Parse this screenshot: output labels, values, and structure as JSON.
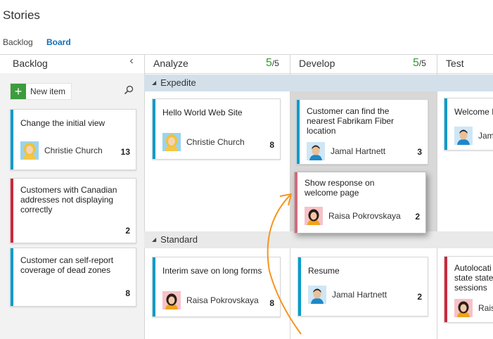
{
  "page": {
    "title": "Stories"
  },
  "tabs": {
    "backlog": "Backlog",
    "board": "Board"
  },
  "columns": {
    "backlog": {
      "label": "Backlog",
      "collapse_icon": "chevron-left-icon"
    },
    "analyze": {
      "label": "Analyze",
      "wip_count": "5",
      "wip_limit": "/5"
    },
    "develop": {
      "label": "Develop",
      "wip_count": "5",
      "wip_limit": "/5"
    },
    "test": {
      "label": "Test"
    }
  },
  "backlog_tools": {
    "new_item_label": "New item",
    "search_icon": "search-icon"
  },
  "lanes": {
    "expedite": "Expedite",
    "standard": "Standard"
  },
  "cards": {
    "backlog": [
      {
        "title": "Change the initial view",
        "assignee": "Christie Church",
        "effort": "13",
        "color": "blue"
      },
      {
        "title": "Customers with Canadian addresses not displaying correctly",
        "assignee": "",
        "effort": "2",
        "color": "red"
      },
      {
        "title": "Customer can self-report coverage of dead zones",
        "assignee": "",
        "effort": "8",
        "color": "blue"
      }
    ],
    "analyze_expedite": {
      "title": "Hello World Web Site",
      "assignee": "Christie Church",
      "effort": "8"
    },
    "analyze_standard": {
      "title": "Interim save on long forms",
      "assignee": "Raisa Pokrovskaya",
      "effort": "8"
    },
    "develop_expedite": {
      "title": "Customer can find the nearest Fabrikam Fiber location",
      "assignee": "Jamal Hartnett",
      "effort": "3"
    },
    "develop_dragging": {
      "title": "Show response on welcome page",
      "assignee": "Raisa Pokrovskaya",
      "effort": "2"
    },
    "develop_standard": {
      "title": "Resume",
      "assignee": "Jamal Hartnett",
      "effort": "2"
    },
    "test_expedite": {
      "title": "Welcome I",
      "assignee": "Jama"
    },
    "test_standard": {
      "title": "Autolocati state state sessions",
      "assignee": "Rais"
    }
  },
  "colors": {
    "accent": "#106ebe",
    "wip_ok": "#339933",
    "bar_blue": "#009ccc",
    "bar_red": "#cc293d",
    "arrow": "#f7941d"
  }
}
